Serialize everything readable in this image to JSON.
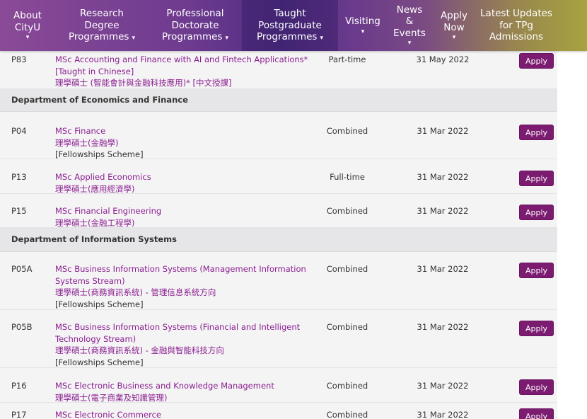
{
  "nav": {
    "items": [
      {
        "label": "About\nCityU",
        "chev": "⌄",
        "style": "stack",
        "w": 78
      },
      {
        "label": "Research\nDegree\nProgrammes",
        "chev": "⌄",
        "style": "inline",
        "w": 132
      },
      {
        "label": "Professional\nDoctorate\nProgrammes",
        "chev": "⌄",
        "style": "inline",
        "w": 132
      },
      {
        "label": "Taught\nPostgraduate\nProgrammes",
        "chev": "⌄",
        "style": "inline",
        "w": 136
      },
      {
        "label": "Visiting",
        "chev": "⌄",
        "style": "stack",
        "w": 70
      },
      {
        "label": "News\n&\nEvents",
        "chev": "⌄",
        "style": "stack",
        "w": 62
      },
      {
        "label": "Apply\nNow",
        "chev": "⌄",
        "style": "stack",
        "w": 64
      },
      {
        "label": "Latest Updates\nfor TPg\nAdmissions",
        "chev": "",
        "style": "stack",
        "w": 112
      }
    ]
  },
  "apply_label": "Apply",
  "rows": [
    {
      "type": "prog",
      "code": "P83",
      "en": "MSc Accounting and Finance with AI and Fintech Applications*",
      "en2": "[Taught in Chinese]",
      "zh": "理學碩士 (智能會計與金融科技應用)* [中文授課]",
      "note": "",
      "mode": "Part-time",
      "date": "31 May 2022"
    },
    {
      "type": "dept",
      "name": "Department of Economics and Finance"
    },
    {
      "type": "prog",
      "code": "P04",
      "en": "MSc Finance",
      "en2": "",
      "zh": "理學碩士(金融學)",
      "note": "[Fellowships Scheme]",
      "mode": "Combined",
      "date": "31 Mar 2022"
    },
    {
      "type": "prog",
      "code": "P13",
      "en": "MSc Applied Economics",
      "en2": "",
      "zh": "理學碩士(應用經濟學)",
      "note": "",
      "mode": "Full-time",
      "date": "31 Mar 2022"
    },
    {
      "type": "prog",
      "code": "P15",
      "en": "MSc Financial Engineering",
      "en2": "",
      "zh": "理學碩士(金融工程學)",
      "note": "",
      "mode": "Combined",
      "date": "31 Mar 2022"
    },
    {
      "type": "dept",
      "name": "Department of Information Systems"
    },
    {
      "type": "prog",
      "code": "P05A",
      "en": "MSc Business Information Systems (Management Information Systems Stream)",
      "en2": "",
      "zh": "理學碩士(商務資訊系統) - 管理信息系統方向",
      "note": "[Fellowships Scheme]",
      "mode": "Combined",
      "date": "31 Mar 2022"
    },
    {
      "type": "prog",
      "code": "P05B",
      "en": "MSc Business Information Systems (Financial and Intelligent Technology Stream)",
      "en2": "",
      "zh": "理學碩士(商務資訊系統) - 金融與智能科技方向",
      "note": "[Fellowships Scheme]",
      "mode": "Combined",
      "date": "31 Mar 2022"
    },
    {
      "type": "prog",
      "code": "P16",
      "en": "MSc Electronic Business and Knowledge Management",
      "en2": "",
      "zh": "理學碩士(電子商業及知識管理)",
      "note": "",
      "mode": "Combined",
      "date": "31 Mar 2022"
    },
    {
      "type": "prog",
      "code": "P17",
      "en": "MSc Electronic Commerce",
      "en2": "",
      "zh": "",
      "note": "",
      "mode": "Combined",
      "date": "31 Mar 2022"
    }
  ]
}
